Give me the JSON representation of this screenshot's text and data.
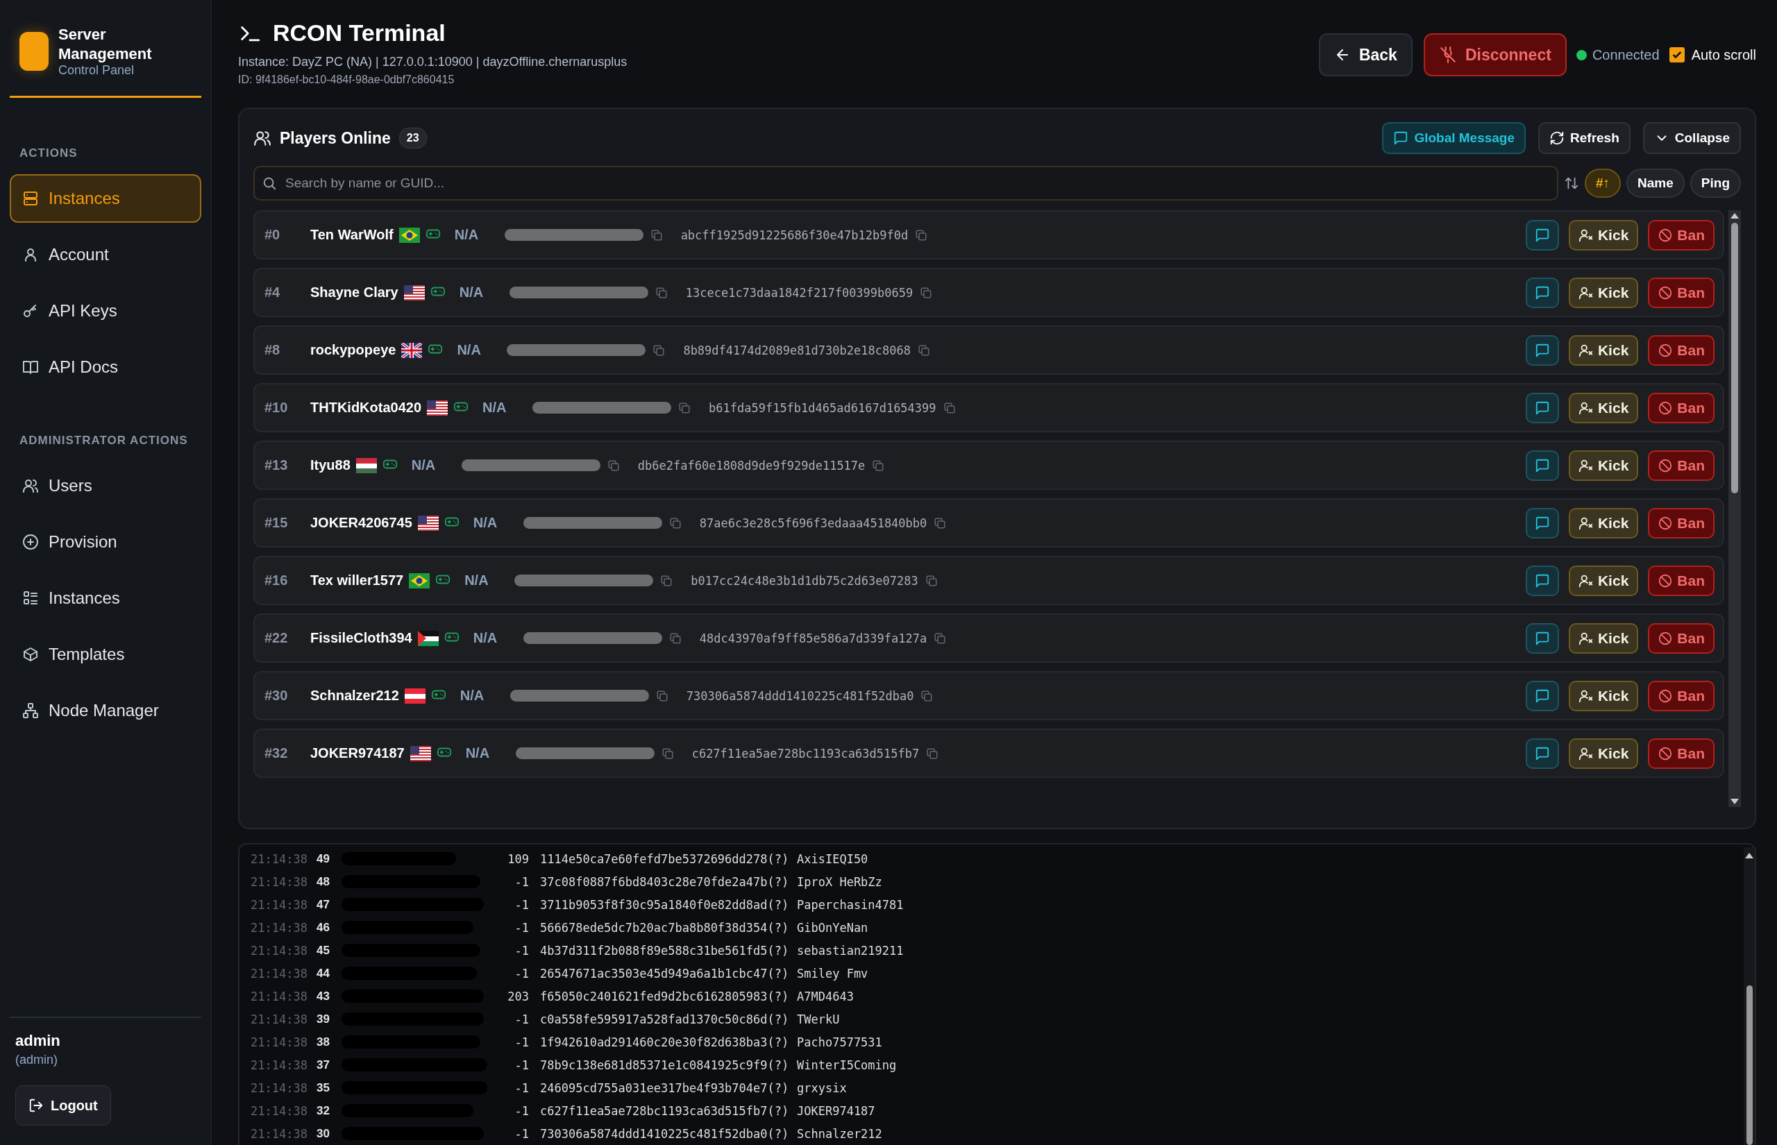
{
  "sidebar": {
    "brand": {
      "title": "Server Management",
      "subtitle": "Control Panel"
    },
    "sections": [
      {
        "heading": "ACTIONS",
        "items": [
          {
            "label": "Instances",
            "kind": "server",
            "selected": true
          },
          {
            "label": "Account",
            "kind": "user",
            "selected": false
          },
          {
            "label": "API Keys",
            "kind": "key",
            "selected": false
          },
          {
            "label": "API Docs",
            "kind": "book",
            "selected": false
          }
        ]
      },
      {
        "heading": "ADMINISTRATOR ACTIONS",
        "items": [
          {
            "label": "Users",
            "kind": "users",
            "selected": false
          },
          {
            "label": "Provision",
            "kind": "plus",
            "selected": false
          },
          {
            "label": "Instances",
            "kind": "list",
            "selected": false
          },
          {
            "label": "Templates",
            "kind": "box",
            "selected": false
          },
          {
            "label": "Node Manager",
            "kind": "nodes",
            "selected": false
          }
        ]
      }
    ],
    "user": {
      "name": "admin",
      "role": "(admin)"
    },
    "logout": "Logout"
  },
  "header": {
    "title": "RCON Terminal",
    "subtitle": "Instance: DayZ PC (NA) | 127.0.0.1:10900 | dayzOffline.chernarusplus",
    "id_line": "ID: 9f4186ef-bc10-484f-98ae-0dbf7c860415",
    "back": "Back",
    "disconnect": "Disconnect",
    "status": {
      "label": "Connected",
      "connected": true
    },
    "auto_scroll": {
      "label": "Auto scroll",
      "checked": true
    }
  },
  "players_panel": {
    "title": "Players Online",
    "count": "23",
    "buttons": [
      {
        "label": "Global Message",
        "kind": "message"
      },
      {
        "label": "Refresh",
        "kind": "refresh"
      },
      {
        "label": "Collapse",
        "kind": "collapse"
      }
    ],
    "search": {
      "placeholder": "Search by name or GUID..."
    },
    "sort": [
      {
        "label": "#↑",
        "selected": true
      },
      {
        "label": "Name",
        "selected": false
      },
      {
        "label": "Ping",
        "selected": false
      }
    ],
    "players": [
      {
        "id": "#0",
        "name": "Ten WarWolf",
        "flag": {
          "kind": "brazil"
        },
        "ping": "N/A",
        "guid": "abcff1925d91225686f30e47b12b9f0d",
        "kick": "Kick",
        "ban": "Ban"
      },
      {
        "id": "#4",
        "name": "Shayne Clary",
        "flag": {
          "kind": "usa"
        },
        "ping": "N/A",
        "guid": "13cece1c73daa1842f217f00399b0659",
        "kick": "Kick",
        "ban": "Ban"
      },
      {
        "id": "#8",
        "name": "rockypopeye",
        "flag": {
          "kind": "uk"
        },
        "ping": "N/A",
        "guid": "8b89df4174d2089e81d730b2e18c8068",
        "kick": "Kick",
        "ban": "Ban"
      },
      {
        "id": "#10",
        "name": "THTKidKota0420",
        "flag": {
          "kind": "usa"
        },
        "ping": "N/A",
        "guid": "b61fda59f15fb1d465ad6167d1654399",
        "kick": "Kick",
        "ban": "Ban"
      },
      {
        "id": "#13",
        "name": "Ityu88",
        "flag": {
          "kind": "hungary"
        },
        "ping": "N/A",
        "guid": "db6e2faf60e1808d9de9f929de11517e",
        "kick": "Kick",
        "ban": "Ban"
      },
      {
        "id": "#15",
        "name": "JOKER4206745",
        "flag": {
          "kind": "usa"
        },
        "ping": "N/A",
        "guid": "87ae6c3e28c5f696f3edaaa451840bb0",
        "kick": "Kick",
        "ban": "Ban"
      },
      {
        "id": "#16",
        "name": "Tex willer1577",
        "flag": {
          "kind": "brazil"
        },
        "ping": "N/A",
        "guid": "b017cc24c48e3b1d1db75c2d63e07283",
        "kick": "Kick",
        "ban": "Ban"
      },
      {
        "id": "#22",
        "name": "FissileCloth394",
        "flag": {
          "kind": "palestine"
        },
        "ping": "N/A",
        "guid": "48dc43970af9ff85e586a7d339fa127a",
        "kick": "Kick",
        "ban": "Ban"
      },
      {
        "id": "#30",
        "name": "Schnalzer212",
        "flag": {
          "kind": "austria"
        },
        "ping": "N/A",
        "guid": "730306a5874ddd1410225c481f52dba0",
        "kick": "Kick",
        "ban": "Ban"
      },
      {
        "id": "#32",
        "name": "JOKER974187",
        "flag": {
          "kind": "usa"
        },
        "ping": "N/A",
        "guid": "c627f11ea5ae728bc1193ca63d515fb7",
        "kick": "Kick",
        "ban": "Ban"
      }
    ]
  },
  "console": {
    "lines": [
      {
        "time": "21:14:38",
        "index": "49",
        "ping": "109",
        "guid": "1114e50ca7e60fefd7be5372696dd278(?)",
        "name": "AxisIEQI50"
      },
      {
        "time": "21:14:38",
        "index": "48",
        "ping": "-1",
        "guid": "37c08f0887f6bd8403c28e70fde2a47b(?)",
        "name": "IproX HeRbZz"
      },
      {
        "time": "21:14:38",
        "index": "47",
        "ping": "-1",
        "guid": "3711b9053f8f30c95a1840f0e82dd8ad(?)",
        "name": "Paperchasin4781"
      },
      {
        "time": "21:14:38",
        "index": "46",
        "ping": "-1",
        "guid": "566678ede5dc7b20ac7ba8b80f38d354(?)",
        "name": "GibOnYeNan"
      },
      {
        "time": "21:14:38",
        "index": "45",
        "ping": "-1",
        "guid": "4b37d311f2b088f89e588c31be561fd5(?)",
        "name": "sebastian219211"
      },
      {
        "time": "21:14:38",
        "index": "44",
        "ping": "-1",
        "guid": "26547671ac3503e45d949a6a1b1cbc47(?)",
        "name": "Smiley Fmv"
      },
      {
        "time": "21:14:38",
        "index": "43",
        "ping": "203",
        "guid": "f65050c2401621fed9d2bc6162805983(?)",
        "name": "A7MD4643"
      },
      {
        "time": "21:14:38",
        "index": "39",
        "ping": "-1",
        "guid": "c0a558fe595917a528fad1370c50c86d(?)",
        "name": "TWerkU"
      },
      {
        "time": "21:14:38",
        "index": "38",
        "ping": "-1",
        "guid": "1f942610ad291460c20e30f82d638ba3(?)",
        "name": "Pacho7577531"
      },
      {
        "time": "21:14:38",
        "index": "37",
        "ping": "-1",
        "guid": "78b9c138e681d85371e1c0841925c9f9(?)",
        "name": "WinterI5Coming"
      },
      {
        "time": "21:14:38",
        "index": "35",
        "ping": "-1",
        "guid": "246095cd755a031ee317be4f93b704e7(?)",
        "name": "grxysix"
      },
      {
        "time": "21:14:38",
        "index": "32",
        "ping": "-1",
        "guid": "c627f11ea5ae728bc1193ca63d515fb7(?)",
        "name": "JOKER974187"
      },
      {
        "time": "21:14:38",
        "index": "30",
        "ping": "-1",
        "guid": "730306a5874ddd1410225c481f52dba0(?)",
        "name": "Schnalzer212"
      }
    ]
  }
}
